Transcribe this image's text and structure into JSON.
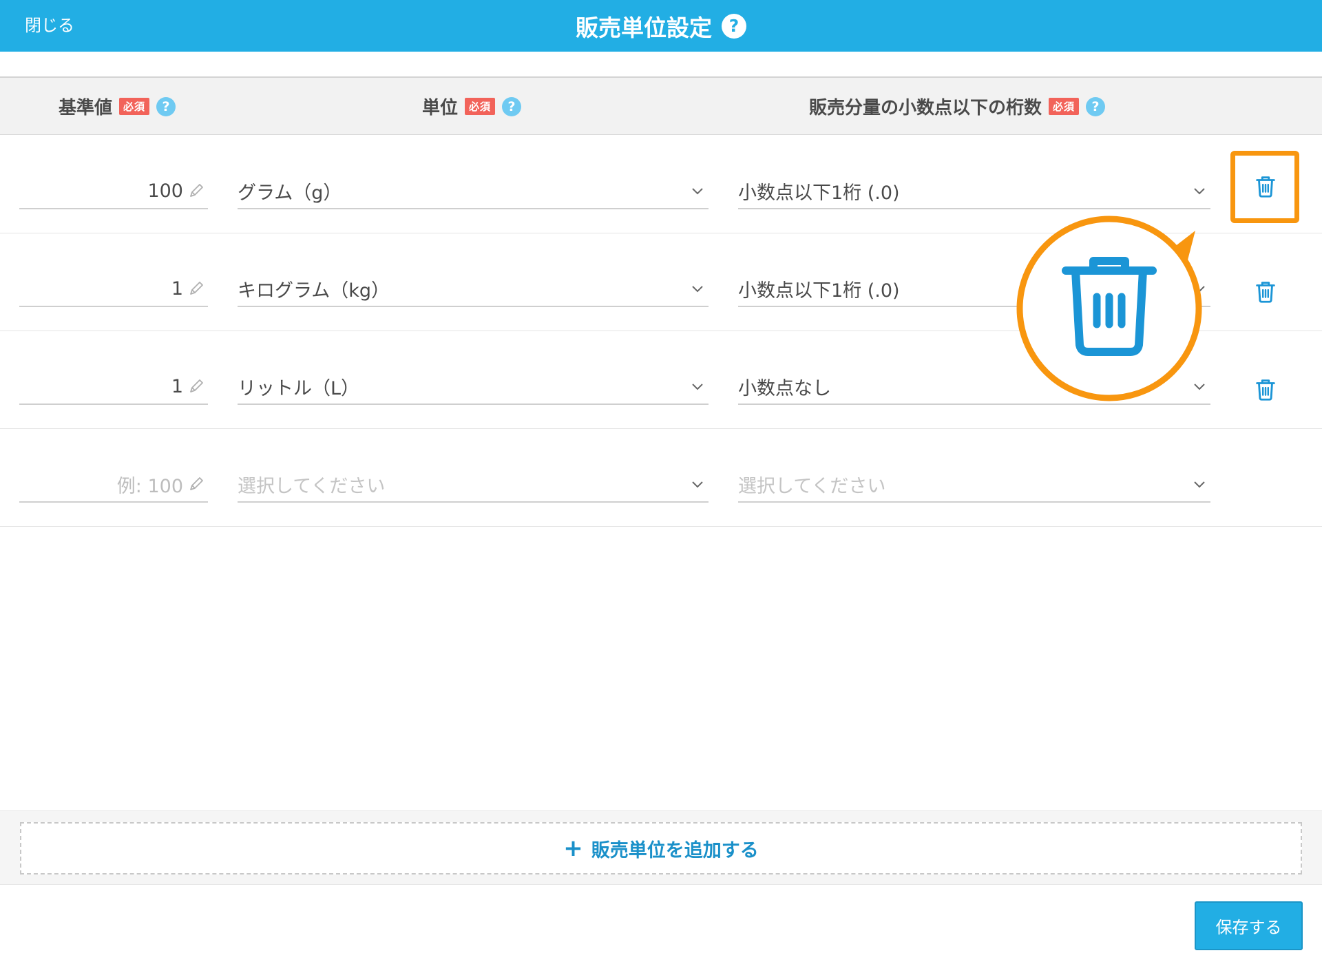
{
  "header": {
    "close_label": "閉じる",
    "title": "販売単位設定",
    "help": "?"
  },
  "columns": [
    {
      "label": "基準値",
      "required": "必須",
      "help": "?"
    },
    {
      "label": "単位",
      "required": "必須",
      "help": "?"
    },
    {
      "label": "販売分量の小数点以下の桁数",
      "required": "必須",
      "help": "?"
    }
  ],
  "rows": [
    {
      "quantity": "100",
      "unit": "グラム（g）",
      "decimals": "小数点以下1桁 (.0)"
    },
    {
      "quantity": "1",
      "unit": "キログラム（kg）",
      "decimals": "小数点以下1桁 (.0)"
    },
    {
      "quantity": "1",
      "unit": "リットル（L）",
      "decimals": "小数点なし"
    }
  ],
  "new_row": {
    "quantity_placeholder": "例: 100",
    "unit_placeholder": "選択してください",
    "decimals_placeholder": "選択してください"
  },
  "add_button": {
    "icon": "+",
    "label": "販売単位を追加する"
  },
  "save_button": {
    "label": "保存する"
  },
  "colors": {
    "header_bar": "#22aee4",
    "trash_icon": "#1b95d6",
    "highlight": "#f8960f",
    "required_badge": "#f2635a",
    "help_icon": "#6fcaf2",
    "add_text": "#1a90c9"
  }
}
